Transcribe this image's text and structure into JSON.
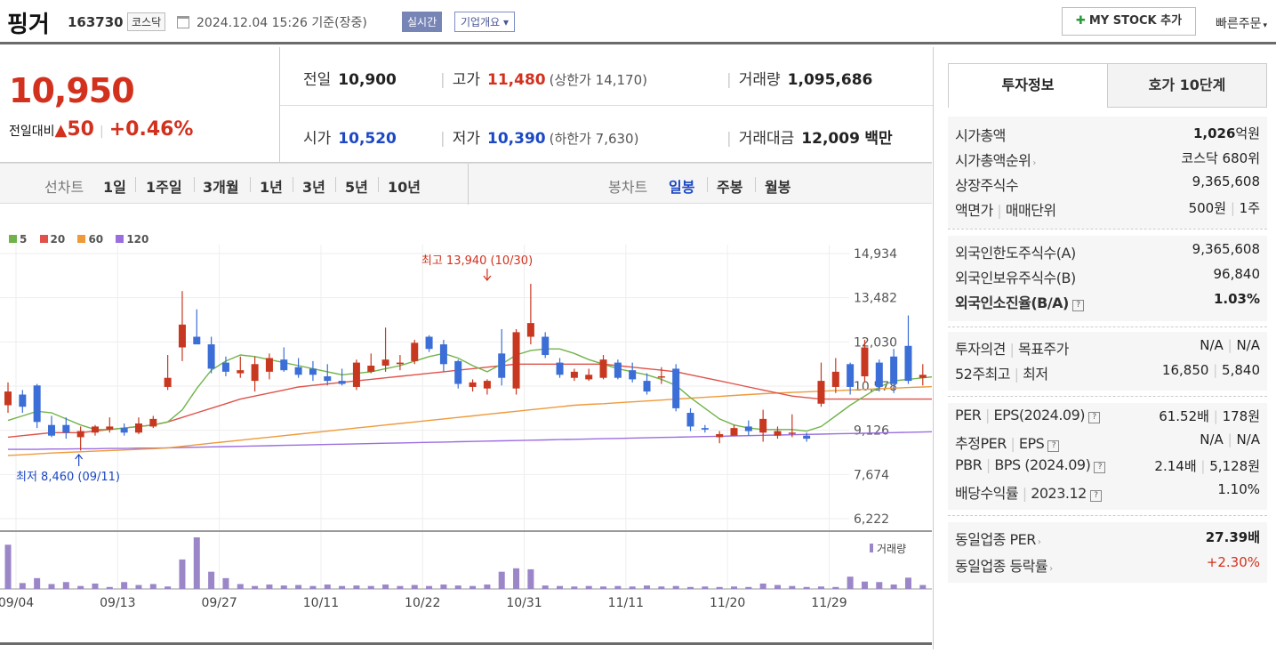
{
  "header": {
    "name": "핑거",
    "code": "163730",
    "market": "코스닥",
    "datetime": "2024.12.04 15:26 기준(장중)",
    "realtime": "실시간",
    "overview": "기업개요",
    "overview_arrow": "▾",
    "mystock": "MY STOCK 추가",
    "mystock_icon": "plus-icon",
    "quick": "빠른주문",
    "quick_arrow": "▾"
  },
  "price": {
    "current": "10,950",
    "change_label": "전일대비",
    "change_arrow": "▲",
    "change": "50",
    "rate": "+0.46%",
    "prev_label": "전일",
    "prev": "10,900",
    "high_label": "고가",
    "high": "11,480",
    "upper": "(상한가 14,170)",
    "volume_label": "거래량",
    "volume": "1,095,686",
    "open_label": "시가",
    "open": "10,520",
    "low_label": "저가",
    "low": "10,390",
    "lower": "(하한가 7,630)",
    "amount_label": "거래대금",
    "amount": "12,009",
    "amount_unit": "백만"
  },
  "periods": {
    "line_label": "선차트",
    "items": [
      "1일",
      "1주일",
      "3개월",
      "1년",
      "3년",
      "5년",
      "10년"
    ],
    "candle_label": "봉차트",
    "candle_items": [
      "일봉",
      "주봉",
      "월봉"
    ],
    "active": "일봉"
  },
  "chart_data": {
    "type": "candlestick",
    "legend": [
      {
        "name": "5",
        "color": "#70b34a"
      },
      {
        "name": "20",
        "color": "#e0524a"
      },
      {
        "name": "60",
        "color": "#ee9a3a"
      },
      {
        "name": "120",
        "color": "#9b6ee0"
      }
    ],
    "yticks": [
      "14,934",
      "13,482",
      "12,030",
      "10,578",
      "9,126",
      "7,674",
      "6,222"
    ],
    "ylim": [
      6222,
      14934
    ],
    "xticks": [
      {
        "label": "09/04",
        "i": 0
      },
      {
        "label": "09/13",
        "i": 7
      },
      {
        "label": "09/27",
        "i": 14
      },
      {
        "label": "10/11",
        "i": 21
      },
      {
        "label": "10/22",
        "i": 28
      },
      {
        "label": "10/31",
        "i": 35
      },
      {
        "label": "11/11",
        "i": 42
      },
      {
        "label": "11/20",
        "i": 49
      },
      {
        "label": "11/29",
        "i": 56
      }
    ],
    "annotations": {
      "high": "최고 13,940 (10/30)",
      "low": "최저 8,460 (09/11)",
      "high_i": 33,
      "low_i": 5
    },
    "volume_label": "거래량",
    "up_color": "#c8371f",
    "down_color": "#3b6ed6",
    "candles": [
      {
        "o": 9950,
        "h": 10700,
        "l": 9700,
        "c": 10400
      },
      {
        "o": 10300,
        "h": 10450,
        "l": 9700,
        "c": 9900
      },
      {
        "o": 10600,
        "h": 10650,
        "l": 9200,
        "c": 9400
      },
      {
        "o": 9300,
        "h": 9600,
        "l": 8900,
        "c": 8950
      },
      {
        "o": 9300,
        "h": 9550,
        "l": 8850,
        "c": 9050
      },
      {
        "o": 8900,
        "h": 9250,
        "l": 8460,
        "c": 9100
      },
      {
        "o": 9050,
        "h": 9300,
        "l": 8950,
        "c": 9250
      },
      {
        "o": 9150,
        "h": 9550,
        "l": 9050,
        "c": 9250
      },
      {
        "o": 9200,
        "h": 9350,
        "l": 8950,
        "c": 9050
      },
      {
        "o": 9050,
        "h": 9550,
        "l": 9000,
        "c": 9350
      },
      {
        "o": 9250,
        "h": 9600,
        "l": 9200,
        "c": 9500
      },
      {
        "o": 10550,
        "h": 11600,
        "l": 10450,
        "c": 10850
      },
      {
        "o": 11850,
        "h": 13700,
        "l": 11400,
        "c": 12600
      },
      {
        "o": 12200,
        "h": 13100,
        "l": 11950,
        "c": 11950
      },
      {
        "o": 11950,
        "h": 12200,
        "l": 11000,
        "c": 11150
      },
      {
        "o": 11350,
        "h": 11550,
        "l": 10900,
        "c": 11050
      },
      {
        "o": 11000,
        "h": 11550,
        "l": 10850,
        "c": 11100
      },
      {
        "o": 10750,
        "h": 11550,
        "l": 10400,
        "c": 11300
      },
      {
        "o": 11050,
        "h": 11650,
        "l": 10800,
        "c": 11500
      },
      {
        "o": 11450,
        "h": 11850,
        "l": 11050,
        "c": 11100
      },
      {
        "o": 11200,
        "h": 11500,
        "l": 10850,
        "c": 10950
      },
      {
        "o": 11150,
        "h": 11400,
        "l": 10750,
        "c": 10950
      },
      {
        "o": 10900,
        "h": 11300,
        "l": 10600,
        "c": 10750
      },
      {
        "o": 10750,
        "h": 11150,
        "l": 10600,
        "c": 10650
      },
      {
        "o": 10550,
        "h": 11450,
        "l": 10450,
        "c": 11350
      },
      {
        "o": 11050,
        "h": 11650,
        "l": 11000,
        "c": 11250
      },
      {
        "o": 11250,
        "h": 12500,
        "l": 11050,
        "c": 11450
      },
      {
        "o": 11300,
        "h": 11600,
        "l": 11100,
        "c": 11350
      },
      {
        "o": 11400,
        "h": 12100,
        "l": 11300,
        "c": 12000
      },
      {
        "o": 12200,
        "h": 12250,
        "l": 11700,
        "c": 11800
      },
      {
        "o": 11950,
        "h": 12100,
        "l": 11050,
        "c": 11300
      },
      {
        "o": 11400,
        "h": 11450,
        "l": 10500,
        "c": 10650
      },
      {
        "o": 10550,
        "h": 10800,
        "l": 10400,
        "c": 10700
      },
      {
        "o": 10500,
        "h": 10800,
        "l": 10300,
        "c": 10750
      },
      {
        "o": 11650,
        "h": 12450,
        "l": 10600,
        "c": 10850
      },
      {
        "o": 10500,
        "h": 12450,
        "l": 10300,
        "c": 12350
      },
      {
        "o": 12200,
        "h": 13940,
        "l": 11950,
        "c": 12650
      },
      {
        "o": 12200,
        "h": 12350,
        "l": 11500,
        "c": 11600
      },
      {
        "o": 11350,
        "h": 11500,
        "l": 10850,
        "c": 10950
      },
      {
        "o": 10850,
        "h": 11150,
        "l": 10750,
        "c": 11050
      },
      {
        "o": 10800,
        "h": 11150,
        "l": 10750,
        "c": 10950
      },
      {
        "o": 10850,
        "h": 11600,
        "l": 10800,
        "c": 11450
      },
      {
        "o": 11350,
        "h": 11450,
        "l": 10800,
        "c": 10850
      },
      {
        "o": 11100,
        "h": 11350,
        "l": 10700,
        "c": 10800
      },
      {
        "o": 10750,
        "h": 11000,
        "l": 10300,
        "c": 10400
      },
      {
        "o": 10900,
        "h": 11200,
        "l": 10650,
        "c": 10900
      },
      {
        "o": 11150,
        "h": 11300,
        "l": 9750,
        "c": 9850
      },
      {
        "o": 9700,
        "h": 9850,
        "l": 9100,
        "c": 9250
      },
      {
        "o": 9200,
        "h": 9300,
        "l": 9050,
        "c": 9150
      },
      {
        "o": 8900,
        "h": 9100,
        "l": 8700,
        "c": 9000
      },
      {
        "o": 8950,
        "h": 9300,
        "l": 8950,
        "c": 9200
      },
      {
        "o": 9250,
        "h": 9450,
        "l": 8950,
        "c": 9100
      },
      {
        "o": 9050,
        "h": 9800,
        "l": 8750,
        "c": 9500
      },
      {
        "o": 8950,
        "h": 9250,
        "l": 8850,
        "c": 9100
      },
      {
        "o": 9050,
        "h": 9650,
        "l": 8900,
        "c": 9050
      },
      {
        "o": 8950,
        "h": 9050,
        "l": 8750,
        "c": 8850
      },
      {
        "o": 10000,
        "h": 11350,
        "l": 9900,
        "c": 10750
      },
      {
        "o": 10550,
        "h": 11500,
        "l": 10350,
        "c": 11050
      },
      {
        "o": 11300,
        "h": 11350,
        "l": 10300,
        "c": 10550
      },
      {
        "o": 10900,
        "h": 12100,
        "l": 10700,
        "c": 11850
      },
      {
        "o": 11350,
        "h": 11450,
        "l": 10400,
        "c": 10550
      },
      {
        "o": 11550,
        "h": 11800,
        "l": 10350,
        "c": 10650
      },
      {
        "o": 11900,
        "h": 12900,
        "l": 10650,
        "c": 10750
      },
      {
        "o": 10850,
        "h": 11300,
        "l": 10600,
        "c": 10950
      },
      {
        "o": 10520,
        "h": 11480,
        "l": 10390,
        "c": 10950
      }
    ],
    "ma5": [
      9450,
      9600,
      9750,
      9700,
      9500,
      9300,
      9150,
      9150,
      9200,
      9250,
      9300,
      9400,
      9800,
      10500,
      11100,
      11400,
      11600,
      11550,
      11450,
      11350,
      11250,
      11150,
      11050,
      10950,
      11000,
      11050,
      11150,
      11250,
      11400,
      11550,
      11650,
      11500,
      11250,
      11050,
      11300,
      11600,
      11750,
      11800,
      11800,
      11650,
      11450,
      11300,
      11150,
      11050,
      10950,
      10800,
      10600,
      10200,
      9850,
      9500,
      9300,
      9200,
      9150,
      9150,
      9150,
      9100,
      9250,
      9600,
      9950,
      10250,
      10550,
      10750,
      10800,
      10850,
      10900,
      10950
    ],
    "ma20": [
      8900,
      8950,
      9000,
      9050,
      9050,
      9050,
      9100,
      9150,
      9200,
      9250,
      9300,
      9400,
      9550,
      9700,
      9850,
      10000,
      10150,
      10250,
      10350,
      10450,
      10550,
      10600,
      10650,
      10700,
      10750,
      10800,
      10850,
      10900,
      10950,
      11000,
      11050,
      11100,
      11150,
      11200,
      11250,
      11300,
      11300,
      11300,
      11300,
      11300,
      11300,
      11300,
      11250,
      11200,
      11150,
      11100,
      11050,
      10950,
      10850,
      10750,
      10650,
      10550,
      10450,
      10350,
      10250,
      10200,
      10150,
      10150,
      10150,
      10150,
      10150,
      10150,
      10150,
      10150,
      10150,
      10150
    ],
    "ma60": [
      8300,
      8320,
      8350,
      8380,
      8400,
      8420,
      8440,
      8460,
      8480,
      8500,
      8520,
      8550,
      8600,
      8650,
      8700,
      8750,
      8800,
      8850,
      8900,
      8950,
      9000,
      9050,
      9100,
      9150,
      9200,
      9250,
      9300,
      9350,
      9400,
      9450,
      9500,
      9550,
      9600,
      9650,
      9700,
      9750,
      9800,
      9850,
      9900,
      9950,
      9980,
      10000,
      10030,
      10060,
      10090,
      10120,
      10150,
      10180,
      10210,
      10240,
      10270,
      10300,
      10330,
      10350,
      10370,
      10390,
      10410,
      10430,
      10450,
      10470,
      10490,
      10510,
      10530,
      10550,
      10570,
      10590
    ],
    "ma120": [
      8500,
      8500,
      8500,
      8510,
      8510,
      8520,
      8520,
      8530,
      8530,
      8540,
      8540,
      8550,
      8560,
      8570,
      8580,
      8590,
      8600,
      8610,
      8620,
      8630,
      8640,
      8650,
      8660,
      8670,
      8680,
      8690,
      8700,
      8710,
      8720,
      8730,
      8740,
      8750,
      8760,
      8770,
      8780,
      8790,
      8800,
      8810,
      8820,
      8830,
      8840,
      8850,
      8860,
      8870,
      8880,
      8890,
      8900,
      8910,
      8920,
      8930,
      8940,
      8950,
      8960,
      8970,
      8980,
      8990,
      9000,
      9010,
      9020,
      9030,
      9040,
      9050,
      9060,
      9070,
      9080,
      9090
    ],
    "volumes": [
      900000,
      120000,
      220000,
      100000,
      140000,
      60000,
      110000,
      40000,
      140000,
      80000,
      100000,
      50000,
      600000,
      1050000,
      350000,
      220000,
      100000,
      60000,
      90000,
      70000,
      80000,
      60000,
      90000,
      60000,
      70000,
      60000,
      90000,
      60000,
      80000,
      60000,
      90000,
      70000,
      60000,
      90000,
      350000,
      420000,
      400000,
      70000,
      60000,
      50000,
      60000,
      50000,
      60000,
      50000,
      70000,
      50000,
      60000,
      40000,
      50000,
      40000,
      50000,
      40000,
      110000,
      80000,
      60000,
      40000,
      50000,
      40000,
      250000,
      150000,
      140000,
      90000,
      230000,
      80000,
      90000,
      60000
    ]
  },
  "invest": {
    "tab1": "투자정보",
    "tab2": "호가 10단계",
    "rows1": [
      {
        "k": "시가총액",
        "v": "1,026",
        "u": "억원"
      },
      {
        "k": "시가총액순위",
        "v": "코스닥 680위"
      },
      {
        "k": "상장주식수",
        "v": "9,365,608"
      },
      {
        "k": "액면가",
        "k2": "매매단위",
        "v": "500원",
        "v2": "1주"
      }
    ],
    "rows2": [
      {
        "k": "외국인한도주식수(A)",
        "v": "9,365,608"
      },
      {
        "k": "외국인보유주식수(B)",
        "v": "96,840"
      },
      {
        "k": "외국인소진율(B/A)",
        "v": "1.03%"
      }
    ],
    "rows3": [
      {
        "k": "투자의견",
        "k2": "목표주가",
        "v": "N/A",
        "v2": "N/A"
      },
      {
        "k": "52주최고",
        "k2": "최저",
        "v": "16,850",
        "v2": "5,840"
      }
    ],
    "rows4": [
      {
        "k": "PER",
        "k2": "EPS(2024.09)",
        "v": "61.52배",
        "v2": "178원"
      },
      {
        "k": "추정PER",
        "k2": "EPS",
        "v": "N/A",
        "v2": "N/A"
      },
      {
        "k": "PBR",
        "k2": "BPS (2024.09)",
        "v": "2.14배",
        "v2": "5,128원"
      },
      {
        "k": "배당수익률",
        "k2": "2023.12",
        "v": "1.10%"
      }
    ],
    "rows5": [
      {
        "k": "동일업종 PER",
        "v": "27.39배"
      },
      {
        "k": "동일업종 등락률",
        "v": "+2.30%"
      }
    ],
    "help": "?",
    "more": "›",
    "sep": "|"
  }
}
